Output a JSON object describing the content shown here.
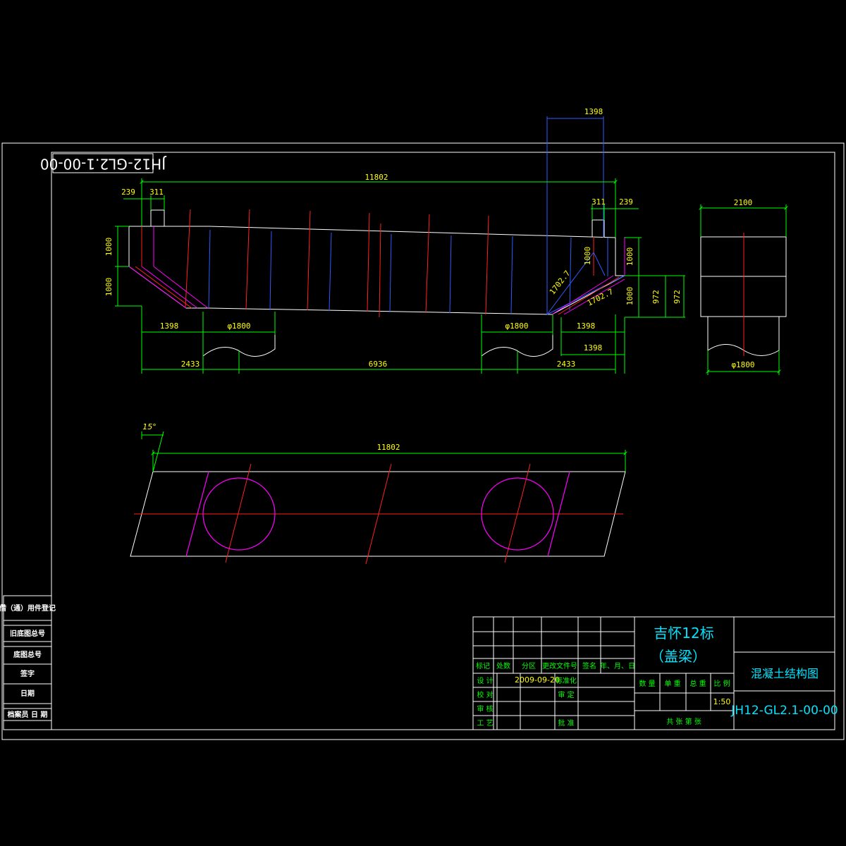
{
  "drawing_no_rotated": "JH12-GL2.1-00-00",
  "elevation": {
    "dim_total": "11802",
    "dim_239_left": "239",
    "dim_311_left": "311",
    "dim_311_right": "311",
    "dim_239_right": "239",
    "dim_1398_top": "1398",
    "dim_1000_a": "1000",
    "dim_1000_b": "1000",
    "dim_1000_c": "1000",
    "dim_1000_d": "1000",
    "dim_1000_e": "1000",
    "dim_1702_a": "1702.7",
    "dim_1702_b": "1702.7",
    "dim_972_a": "972",
    "dim_972_b": "972",
    "dim_1398_left": "1398",
    "dim_1398_right_a": "1398",
    "dim_1398_right_b": "1398",
    "dim_phi_left": "φ1800",
    "dim_phi_right": "φ1800",
    "dim_2433_left": "2433",
    "dim_6936": "6936",
    "dim_2433_right": "2433"
  },
  "side_view": {
    "dim_width": "2100",
    "dim_phi": "φ1800"
  },
  "plan_view": {
    "angle": "15°",
    "dim_total": "11802"
  },
  "side_table": {
    "rows": [
      "借（通）用件登记",
      "旧底图总号",
      "底图总号",
      "签字",
      "日期",
      "档案员 日 期"
    ]
  },
  "title_block": {
    "project_line1": "吉怀12标",
    "project_line2": "（盖梁）",
    "drawing_title": "混凝土结构图",
    "drawing_no": "JH12-GL2.1-00-00",
    "header_mark": "标记",
    "header_count": "处数",
    "header_zone": "分区",
    "header_doc": "更改文件号",
    "header_sign": "签名",
    "header_date": "年、月、日",
    "label_design": "设 计",
    "design_date": "2009-09-20",
    "label_standard": "标准化",
    "label_check": "校 对",
    "label_review": "审 定",
    "label_audit": "审 核",
    "label_process": "工 艺",
    "label_approve": "批 准",
    "label_qty": "数 量",
    "label_unit_wt": "单 重",
    "label_total_wt": "总 重",
    "label_scale": "比 例",
    "scale_value": "1:50",
    "sheet_info": "共 张 第 张"
  },
  "colors": {
    "background": "#000000",
    "outline": "#ffffff",
    "dimension": "#00ff00",
    "dim_text": "#ffff00",
    "centerline": "#ff2020",
    "blue": "#2f5bff",
    "magenta": "#ff00ff",
    "title_cyan": "#00e5ff"
  }
}
